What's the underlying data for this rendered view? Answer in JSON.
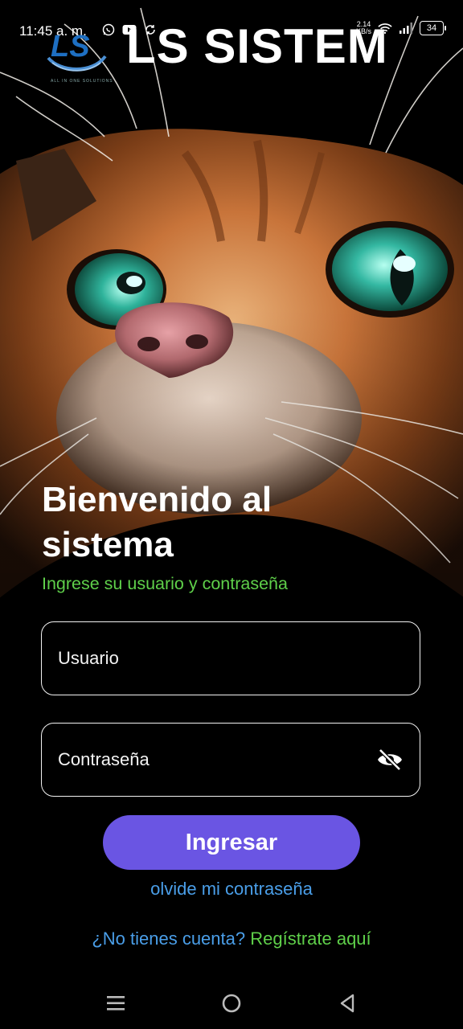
{
  "status_bar": {
    "time": "11:45 a. m.",
    "net_rate_value": "2.14",
    "net_rate_unit": "KB/s",
    "battery": "34",
    "left_icons": [
      "whatsapp-icon",
      "youtube-icon",
      "sync-icon"
    ],
    "right_icons": [
      "wifi-icon",
      "signal-icon",
      "battery-icon"
    ]
  },
  "brand": {
    "logo_text": "LS",
    "logo_caption": "ALL IN ONE SOLUTIONS",
    "title": "LS SISTEM"
  },
  "welcome": {
    "title_line1": "Bienvenido al",
    "title_line2": "sistema",
    "subtitle": "Ingrese su usuario y contraseña"
  },
  "form": {
    "username_placeholder": "Usuario",
    "username_value": "",
    "password_placeholder": "Contraseña",
    "password_value": "",
    "password_toggle_icon": "eye-off-icon",
    "login_label": "Ingresar"
  },
  "links": {
    "forgot_password": "olvide mi contraseña",
    "register_question": "¿No tienes cuenta?",
    "register_action": "Regístrate aquí"
  },
  "colors": {
    "accent_button": "#6a55e3",
    "subtitle_green": "#5fd04a",
    "link_blue": "#4a9ee8",
    "background": "#000000"
  },
  "navbar": {
    "buttons": [
      "menu-icon",
      "home-icon",
      "back-icon"
    ]
  }
}
